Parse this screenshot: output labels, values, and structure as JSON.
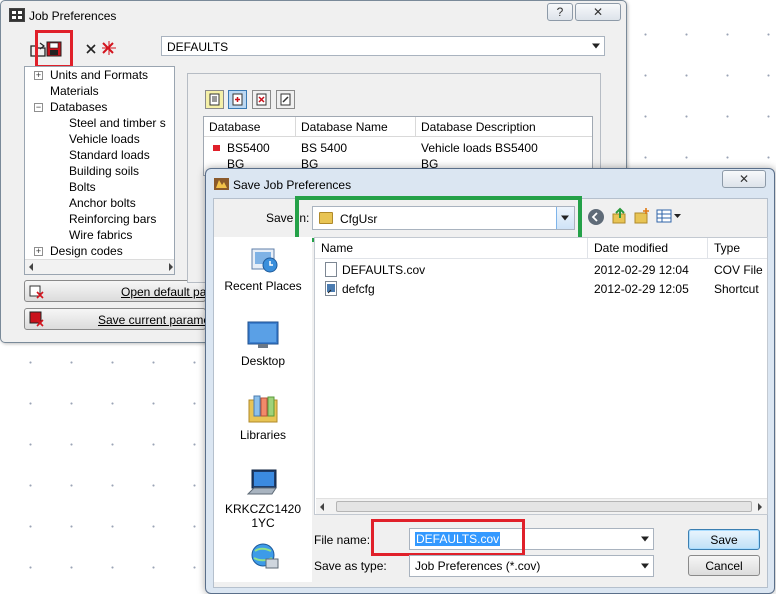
{
  "job_prefs": {
    "title": "Job Preferences",
    "help_glyph": "?",
    "close_glyph": "✕",
    "preset_value": "DEFAULTS",
    "tree": [
      {
        "label": "Units and Formats",
        "expander": "+"
      },
      {
        "label": "Materials",
        "expander": ""
      },
      {
        "label": "Databases",
        "expander": "−"
      },
      {
        "label": "Steel and timber s",
        "expander": ""
      },
      {
        "label": "Vehicle loads",
        "expander": ""
      },
      {
        "label": "Standard loads",
        "expander": ""
      },
      {
        "label": "Building soils",
        "expander": ""
      },
      {
        "label": "Bolts",
        "expander": ""
      },
      {
        "label": "Anchor bolts",
        "expander": ""
      },
      {
        "label": "Reinforcing bars",
        "expander": ""
      },
      {
        "label": "Wire fabrics",
        "expander": ""
      },
      {
        "label": "Design codes",
        "expander": "+"
      }
    ],
    "open_default_label": "Open default para",
    "save_current_label": "Save current paramete",
    "table": {
      "headers": [
        "Database",
        "Database Name",
        "Database Description"
      ],
      "rows": [
        {
          "db": "BS5400",
          "name": "BS 5400",
          "desc": "Vehicle loads BS5400"
        },
        {
          "db": "BG",
          "name": "BG",
          "desc": "BG"
        }
      ]
    }
  },
  "save_dialog": {
    "title": "Save Job Preferences",
    "close_glyph": "✕",
    "save_in_label": "Save in:",
    "save_in_value": "CfgUsr",
    "places": [
      {
        "label": "Recent Places",
        "icon": "recent-places-icon"
      },
      {
        "label": "Desktop",
        "icon": "desktop-icon"
      },
      {
        "label": "Libraries",
        "icon": "libraries-icon"
      },
      {
        "label": "KRKCZC14201YC",
        "icon": "computer-icon"
      },
      {
        "label": "",
        "icon": "network-icon"
      }
    ],
    "columns": [
      "Name",
      "Date modified",
      "Type"
    ],
    "files": [
      {
        "name": "DEFAULTS.cov",
        "date": "2012-02-29 12:04",
        "type": "COV File",
        "icon": "file-icon"
      },
      {
        "name": "defcfg",
        "date": "2012-02-29 12:05",
        "type": "Shortcut",
        "icon": "shortcut-icon"
      }
    ],
    "file_name_label": "File name:",
    "file_name_value": "DEFAULTS.cov",
    "save_as_type_label": "Save as type:",
    "save_as_type_value": "Job Preferences (*.cov)",
    "save_button": "Save",
    "cancel_button": "Cancel"
  },
  "colors": {
    "highlight_red": "#e0202a",
    "highlight_green": "#24a148",
    "selection_blue": "#3399ff"
  }
}
